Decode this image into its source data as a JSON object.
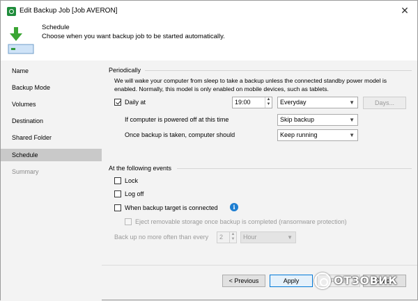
{
  "window": {
    "title": "Edit Backup Job [Job AVERON]",
    "close_glyph": "✕",
    "app_icon": "veeam-agent-icon"
  },
  "header": {
    "title": "Schedule",
    "description": "Choose when you want backup job to be started automatically.",
    "icon": "download-arrow-drive-icon"
  },
  "sidebar": {
    "items": [
      {
        "label": "Name",
        "state": "normal"
      },
      {
        "label": "Backup Mode",
        "state": "normal"
      },
      {
        "label": "Volumes",
        "state": "normal"
      },
      {
        "label": "Destination",
        "state": "normal"
      },
      {
        "label": "Shared Folder",
        "state": "normal"
      },
      {
        "label": "Schedule",
        "state": "active"
      },
      {
        "label": "Summary",
        "state": "disabled"
      }
    ]
  },
  "periodically": {
    "heading": "Periodically",
    "note": "We will wake your computer from sleep to take a backup unless the connected standby power model is enabled. Normally, this model is only enabled on mobile devices, such as tablets.",
    "daily_at_label": "Daily at",
    "daily_at_checked": true,
    "time_value": "19:00",
    "frequency_value": "Everyday",
    "days_button": "Days...",
    "powered_off_label": "If computer is powered off at this time",
    "powered_off_value": "Skip backup",
    "after_backup_label": "Once backup is taken, computer should",
    "after_backup_value": "Keep running"
  },
  "events": {
    "heading": "At the following events",
    "lock_label": "Lock",
    "logoff_label": "Log off",
    "target_connected_label": "When backup target is connected",
    "eject_label": "Eject removable storage once backup is completed (ransomware protection)",
    "no_more_often_label": "Back up no more often than every",
    "interval_value": "2",
    "interval_unit": "Hour"
  },
  "footer": {
    "previous": "< Previous",
    "apply": "Apply",
    "finish": "Finish",
    "cancel": "Cancel"
  },
  "watermark": {
    "text": "ОТЗОВИК"
  },
  "colors": {
    "accent": "#0078d7",
    "brand_green": "#1f8c3b",
    "info_blue": "#1e7ed1",
    "selected_nav": "#c9c9c9",
    "panel_bg": "#f3f3f3"
  }
}
